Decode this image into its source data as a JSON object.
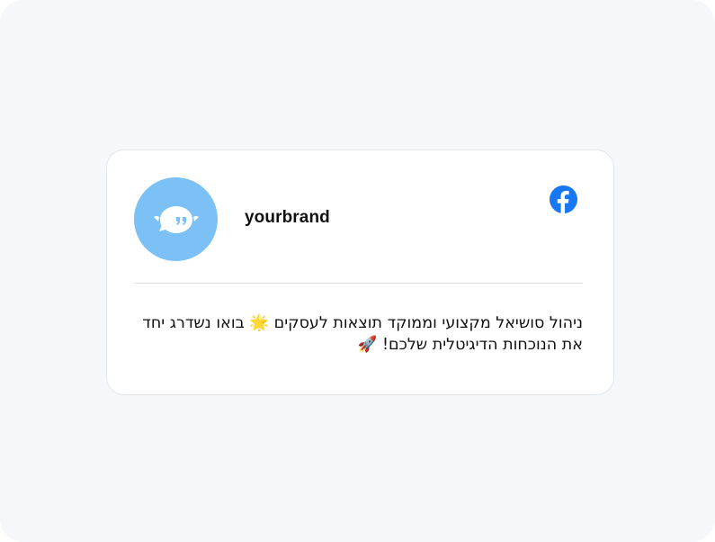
{
  "card": {
    "username": "yourbrand",
    "platform_icon": "facebook-icon",
    "avatar_icon": "speech-bubble-quote-icon",
    "post_text_line1": "ניהול סושיאל מקצועי וממוקד תוצאות לעסקים 🌟 בואו נשדרג יחד",
    "post_text_line2": "את הנוכחות הדיגיטלית שלכם! 🚀"
  },
  "colors": {
    "background": "#f5f7fb",
    "card": "#ffffff",
    "avatar": "#7cc1f6",
    "facebook": "#1877f2",
    "text": "#111111"
  }
}
